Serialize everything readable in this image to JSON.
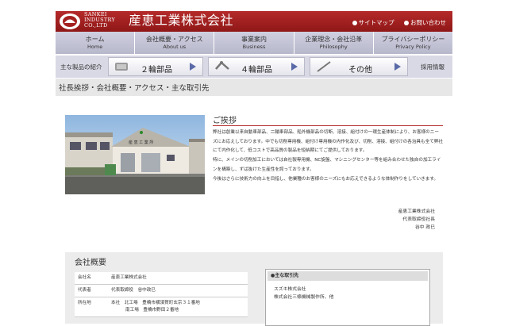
{
  "header": {
    "logo_en_lines": [
      "SANKEI",
      "INDUSTRY",
      "CO.,LTD"
    ],
    "logo_jp": "産恵工業株式会社",
    "links": [
      {
        "label": "サイトマップ"
      },
      {
        "label": "お問い合わせ"
      }
    ]
  },
  "nav": [
    {
      "jp": "ホーム",
      "en": "Home"
    },
    {
      "jp": "会社概要・アクセス",
      "en": "About us"
    },
    {
      "jp": "事業案内",
      "en": "Business"
    },
    {
      "jp": "企業理念・会社沿革",
      "en": "Philosophy"
    },
    {
      "jp": "プライバシーポリシー",
      "en": "Privacy Policy"
    }
  ],
  "products": {
    "label": "主な製品の紹介",
    "buttons": [
      {
        "label": "２輪部品",
        "icon": "bike-parts-icon"
      },
      {
        "label": "４輪部品",
        "icon": "car-parts-icon"
      },
      {
        "label": "その他",
        "icon": "other-parts-icon"
      }
    ],
    "recruit": "採用情報"
  },
  "breadcrumb": "社長挨拶・会社概要・アクセス・主な取引先",
  "photo": {
    "sign_text": "産 恵 工 業 所"
  },
  "greeting": {
    "title": "ご挨拶",
    "paragraphs": [
      "弊社は創業以来自動車部品、二輪車部品、船外機部品の切断、溶接、組付けの一環生産体制により、お客様のニーズにお応えしております。中でも切削専用機、組付け専用機の内作化及び、切削、溶接、組付けの各治具も全て弊社にて内作化して、低コストで高品質の製品を短納期にてご提供しております。",
      "特に、メインの切削加工においては自社製専用機、NC旋盤、マシニングセンター等を組み合わせた独自の加工ラインを構築し、ずば抜けた生産性を誇っております。",
      "今後はさらに技術力の向上を目指し、他業種のお客様のニーズにもお応えできるような体制作りをしていきます。"
    ],
    "signature": [
      "産恵工業株式会社",
      "代表取締役社長",
      "谷中 政巳"
    ]
  },
  "company": {
    "title": "会社概要",
    "rows": [
      {
        "key": "会社名",
        "value": "産恵工業株式会社"
      },
      {
        "key": "代表者",
        "value": "代表取締役　谷中政巳"
      },
      {
        "key": "所在地",
        "value": "本社　北工場　豊橋市横須賀町玄宗３１番地",
        "value2": "南工場　豊橋市野田２番地"
      }
    ],
    "clients_title": "●主な取引先",
    "clients": [
      "スズキ株式会社",
      "株式会社三條機械製作所、他"
    ]
  },
  "colors": {
    "brand_red": "#a52020",
    "nav_bg": "#c4c4d6",
    "arrow_blue": "#5a6aa8"
  }
}
